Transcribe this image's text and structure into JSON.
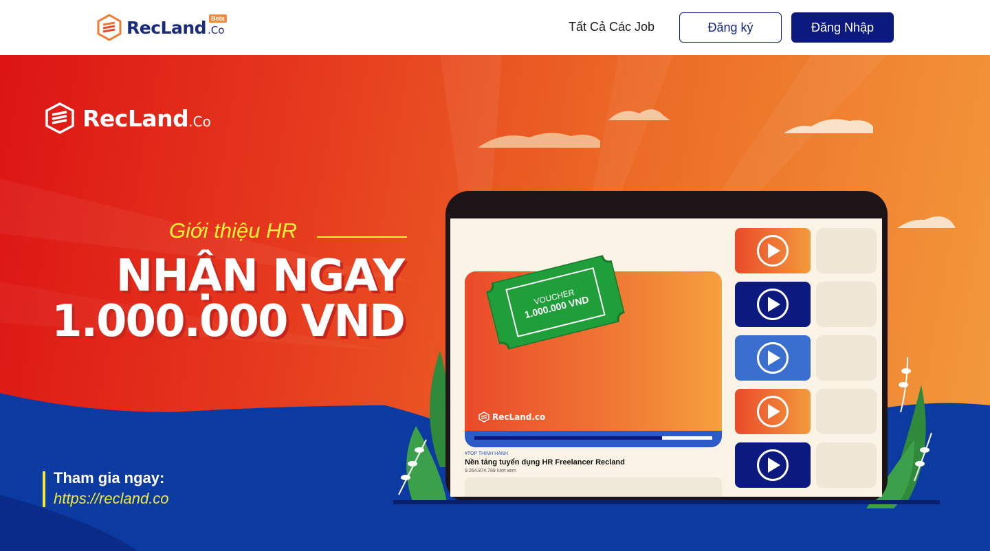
{
  "header": {
    "brand": "RecLand",
    "brand_suffix": ".Co",
    "beta_badge": "Beta",
    "nav_all_jobs": "Tất Cả Các Job",
    "register_label": "Đăng ký",
    "login_label": "Đăng Nhập"
  },
  "banner": {
    "brand": "RecLand",
    "brand_suffix": ".Co",
    "intro": "Giới thiệu HR",
    "headline_line1": "NHẬN NGAY",
    "headline_line2": "1.000.000 VND",
    "join_label": "Tham gia ngay:",
    "join_url": "https://recland.co"
  },
  "laptop": {
    "voucher_label": "VOUCHER",
    "voucher_amount": "1.000.000 VND",
    "video_logo": "RecLand.co",
    "video_progress": 0.79,
    "tag": "#TOP THỊNH HÀNH",
    "video_title": "Nền tảng tuyển dụng HR Freelancer Recland",
    "views": "9.264.874.789 lượt xem",
    "thumbnails": [
      "orange",
      "navy",
      "blue",
      "orange",
      "navy"
    ]
  },
  "colors": {
    "brand_navy": "#0c1a80",
    "banner_red": "#dc1414",
    "banner_orange": "#f39b3c",
    "accent_yellow": "#f4e93a",
    "blue_ground": "#0b3aa0"
  }
}
